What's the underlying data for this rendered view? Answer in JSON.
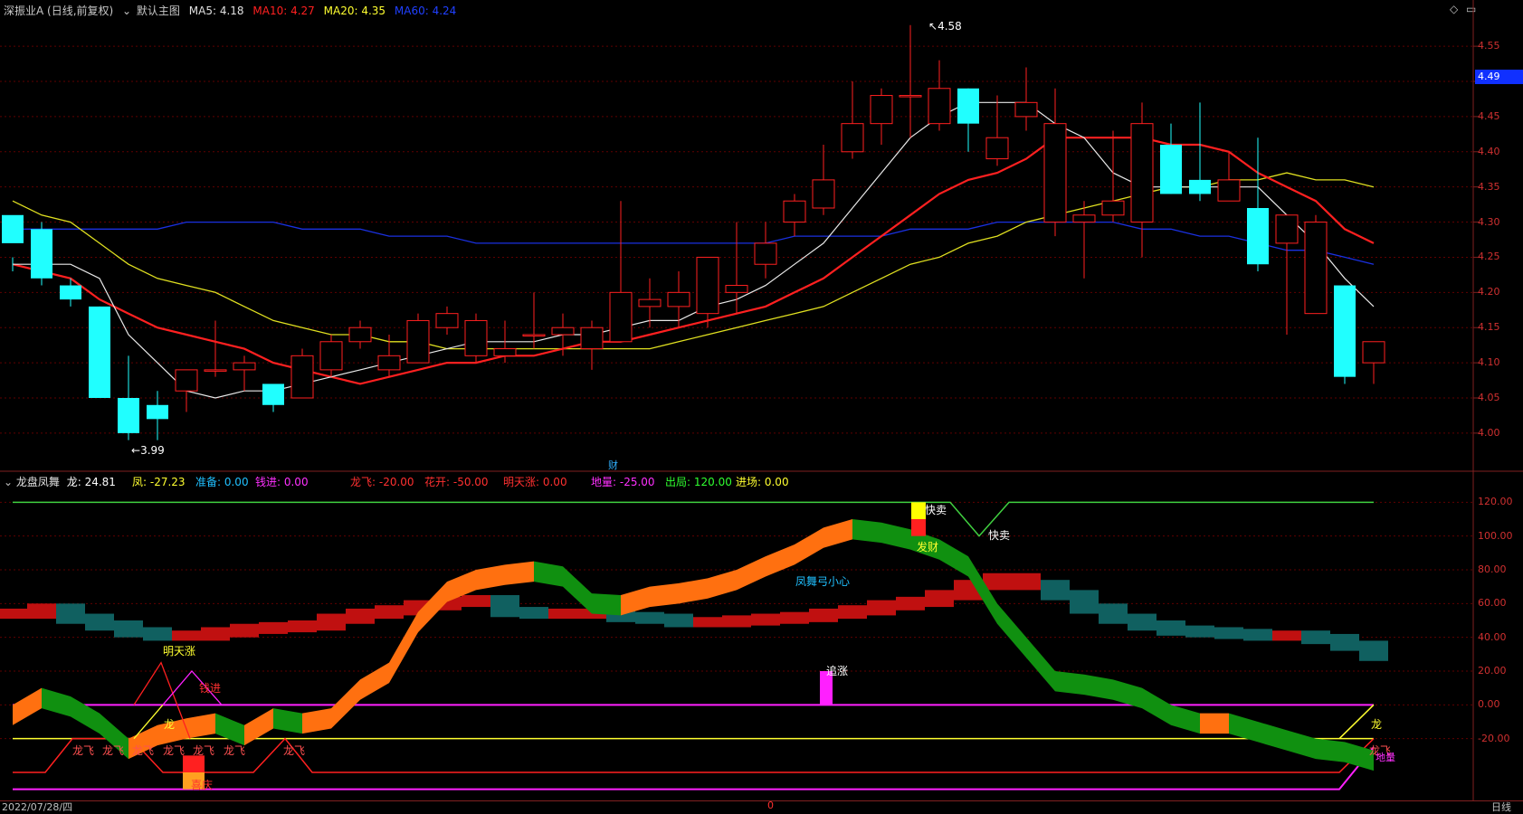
{
  "header": {
    "title": "深振业A (日线,前复权)",
    "main_index": "默认主图",
    "ma": [
      {
        "label": "MA5: 4.18",
        "color": "#e0e0e0"
      },
      {
        "label": "MA10: 4.27",
        "color": "#ff2020"
      },
      {
        "label": "MA20: 4.35",
        "color": "#ffff30"
      },
      {
        "label": "MA60: 4.24",
        "color": "#2040ff"
      }
    ]
  },
  "price_axis": {
    "ticks": [
      "4.55",
      "4.50",
      "4.45",
      "4.40",
      "4.35",
      "4.30",
      "4.25",
      "4.20",
      "4.15",
      "4.10",
      "4.05",
      "4.00"
    ],
    "current": "4.49"
  },
  "annotations": {
    "high": "4.58",
    "low": "3.99",
    "cai": "财"
  },
  "sub_header": {
    "name": "龙盘凤舞",
    "items": [
      {
        "label": "龙: 24.81",
        "color": "#ffffff"
      },
      {
        "label": "凤: -27.23",
        "color": "#ffff30"
      },
      {
        "label": "准备: 0.00",
        "color": "#20c0ff"
      },
      {
        "label": "钱进: 0.00",
        "color": "#ff30ff"
      },
      {
        "label": "龙飞: -20.00",
        "color": "#ff3030"
      },
      {
        "label": "花开: -50.00",
        "color": "#ff3030"
      },
      {
        "label": "明天涨: 0.00",
        "color": "#ff3030"
      },
      {
        "label": "地量: -25.00",
        "color": "#ff30ff"
      },
      {
        "label": "出局: 120.00",
        "color": "#30ff30"
      },
      {
        "label": "进场: 0.00",
        "color": "#ffff30"
      }
    ]
  },
  "sub_axis": {
    "ticks": [
      "120.00",
      "100.00",
      "80.00",
      "60.00",
      "40.00",
      "20.00",
      "0.00",
      "-20.00"
    ]
  },
  "sub_labels": {
    "kuaimai1": "快卖",
    "kuaimai2": "快卖",
    "facai": "发财",
    "fengwu": "凤舞弓小心",
    "mingtianzhang": "明天涨",
    "qianjin": "钱进",
    "long1": "龙",
    "long2": "龙",
    "zhuizhang": "追涨",
    "longfei": [
      "龙飞",
      "龙飞",
      "龙飞",
      "龙飞",
      "龙飞",
      "龙飞",
      "龙飞"
    ],
    "longfei_right": "龙飞",
    "diliang": "地量",
    "xiqing": "喜庆"
  },
  "footer": {
    "date": "2022/07/28/四",
    "zero": "0",
    "period": "日线"
  },
  "colors": {
    "up": "#ff2020",
    "down": "#20ffff",
    "grid": "#600000",
    "orange": "#ff7010",
    "green": "#109010"
  },
  "chart_data": {
    "type": "candlestick",
    "candles": [
      [
        4.27,
        4.31,
        4.25,
        4.23
      ],
      [
        4.22,
        4.29,
        4.3,
        4.21
      ],
      [
        4.19,
        4.21,
        4.22,
        4.18
      ],
      [
        4.05,
        4.18,
        4.18,
        4.05
      ],
      [
        4.0,
        4.05,
        4.11,
        3.99
      ],
      [
        4.02,
        4.04,
        4.06,
        3.99
      ],
      [
        4.09,
        4.06,
        4.09,
        4.03
      ],
      [
        4.09,
        4.09,
        4.16,
        4.08
      ],
      [
        4.1,
        4.09,
        4.11,
        4.06
      ],
      [
        4.04,
        4.07,
        4.07,
        4.03
      ],
      [
        4.11,
        4.05,
        4.12,
        4.05
      ],
      [
        4.13,
        4.09,
        4.14,
        4.08
      ],
      [
        4.15,
        4.13,
        4.16,
        4.12
      ],
      [
        4.11,
        4.09,
        4.14,
        4.08
      ],
      [
        4.16,
        4.1,
        4.17,
        4.1
      ],
      [
        4.17,
        4.15,
        4.18,
        4.14
      ],
      [
        4.16,
        4.11,
        4.17,
        4.1
      ],
      [
        4.12,
        4.11,
        4.16,
        4.1
      ],
      [
        4.14,
        4.14,
        4.2,
        4.12
      ],
      [
        4.15,
        4.14,
        4.17,
        4.11
      ],
      [
        4.15,
        4.12,
        4.16,
        4.09
      ],
      [
        4.2,
        4.13,
        4.33,
        4.13
      ],
      [
        4.19,
        4.18,
        4.22,
        4.15
      ],
      [
        4.2,
        4.18,
        4.23,
        4.15
      ],
      [
        4.25,
        4.17,
        4.25,
        4.15
      ],
      [
        4.21,
        4.2,
        4.3,
        4.17
      ],
      [
        4.27,
        4.24,
        4.3,
        4.22
      ],
      [
        4.33,
        4.3,
        4.34,
        4.28
      ],
      [
        4.36,
        4.32,
        4.41,
        4.31
      ],
      [
        4.44,
        4.4,
        4.5,
        4.39
      ],
      [
        4.48,
        4.44,
        4.49,
        4.41
      ],
      [
        4.48,
        4.48,
        4.58,
        4.42
      ],
      [
        4.49,
        4.44,
        4.53,
        4.43
      ],
      [
        4.44,
        4.49,
        4.49,
        4.4
      ],
      [
        4.42,
        4.39,
        4.48,
        4.38
      ],
      [
        4.47,
        4.45,
        4.52,
        4.43
      ],
      [
        4.44,
        4.3,
        4.49,
        4.28
      ],
      [
        4.31,
        4.3,
        4.33,
        4.22
      ],
      [
        4.33,
        4.31,
        4.43,
        4.3
      ],
      [
        4.44,
        4.3,
        4.47,
        4.25
      ],
      [
        4.34,
        4.41,
        4.44,
        4.34
      ],
      [
        4.34,
        4.36,
        4.47,
        4.33
      ],
      [
        4.36,
        4.33,
        4.4,
        4.33
      ],
      [
        4.24,
        4.32,
        4.42,
        4.23
      ],
      [
        4.31,
        4.27,
        4.31,
        4.14
      ],
      [
        4.3,
        4.17,
        4.31,
        4.17
      ],
      [
        4.08,
        4.21,
        4.21,
        4.07
      ],
      [
        4.13,
        4.1,
        4.13,
        4.07
      ]
    ],
    "ma5": [
      4.24,
      4.24,
      4.24,
      4.22,
      4.14,
      4.1,
      4.06,
      4.05,
      4.06,
      4.06,
      4.07,
      4.08,
      4.09,
      4.1,
      4.11,
      4.12,
      4.13,
      4.13,
      4.13,
      4.14,
      4.14,
      4.15,
      4.16,
      4.16,
      4.18,
      4.19,
      4.21,
      4.24,
      4.27,
      4.32,
      4.37,
      4.42,
      4.45,
      4.47,
      4.47,
      4.47,
      4.44,
      4.42,
      4.37,
      4.35,
      4.35,
      4.35,
      4.35,
      4.35,
      4.31,
      4.27,
      4.22,
      4.18
    ],
    "ma10": [
      4.24,
      4.23,
      4.22,
      4.19,
      4.17,
      4.15,
      4.14,
      4.13,
      4.12,
      4.1,
      4.09,
      4.08,
      4.07,
      4.08,
      4.09,
      4.1,
      4.1,
      4.11,
      4.11,
      4.12,
      4.13,
      4.13,
      4.14,
      4.15,
      4.16,
      4.17,
      4.18,
      4.2,
      4.22,
      4.25,
      4.28,
      4.31,
      4.34,
      4.36,
      4.37,
      4.39,
      4.42,
      4.42,
      4.42,
      4.42,
      4.41,
      4.41,
      4.4,
      4.37,
      4.35,
      4.33,
      4.29,
      4.27
    ],
    "ma20": [
      4.33,
      4.31,
      4.3,
      4.27,
      4.24,
      4.22,
      4.21,
      4.2,
      4.18,
      4.16,
      4.15,
      4.14,
      4.14,
      4.13,
      4.13,
      4.12,
      4.12,
      4.12,
      4.12,
      4.12,
      4.12,
      4.12,
      4.12,
      4.13,
      4.14,
      4.15,
      4.16,
      4.17,
      4.18,
      4.2,
      4.22,
      4.24,
      4.25,
      4.27,
      4.28,
      4.3,
      4.31,
      4.32,
      4.33,
      4.34,
      4.35,
      4.35,
      4.36,
      4.36,
      4.37,
      4.36,
      4.36,
      4.35
    ],
    "ma60": [
      4.29,
      4.29,
      4.29,
      4.29,
      4.29,
      4.29,
      4.3,
      4.3,
      4.3,
      4.3,
      4.29,
      4.29,
      4.29,
      4.28,
      4.28,
      4.28,
      4.27,
      4.27,
      4.27,
      4.27,
      4.27,
      4.27,
      4.27,
      4.27,
      4.27,
      4.27,
      4.27,
      4.28,
      4.28,
      4.28,
      4.28,
      4.29,
      4.29,
      4.29,
      4.3,
      4.3,
      4.3,
      4.3,
      4.3,
      4.29,
      4.29,
      4.28,
      4.28,
      4.27,
      4.26,
      4.26,
      4.25,
      4.24
    ],
    "price_range": [
      3.96,
      4.59
    ],
    "osc_long": [
      55,
      58,
      52,
      48,
      44,
      42,
      42,
      44,
      46,
      47,
      48,
      52,
      55,
      57,
      60,
      62,
      63,
      56,
      55,
      55,
      55,
      53,
      52,
      50,
      50,
      51,
      52,
      53,
      55,
      57,
      60,
      62,
      66,
      72,
      76,
      72,
      66,
      58,
      52,
      48,
      45,
      44,
      43,
      42,
      42,
      40,
      36,
      30
    ],
    "osc_feng": [
      0,
      10,
      5,
      -5,
      -20,
      -12,
      -8,
      -5,
      -12,
      -2,
      -5,
      -2,
      15,
      25,
      55,
      73,
      80,
      83,
      85,
      82,
      66,
      65,
      70,
      72,
      75,
      80,
      88,
      95,
      105,
      110,
      108,
      104,
      98,
      88,
      60,
      40,
      20,
      18,
      15,
      10,
      0,
      -5,
      -5,
      -10,
      -15,
      -20,
      -22,
      -27
    ],
    "osc_range": [
      -25,
      125
    ]
  }
}
